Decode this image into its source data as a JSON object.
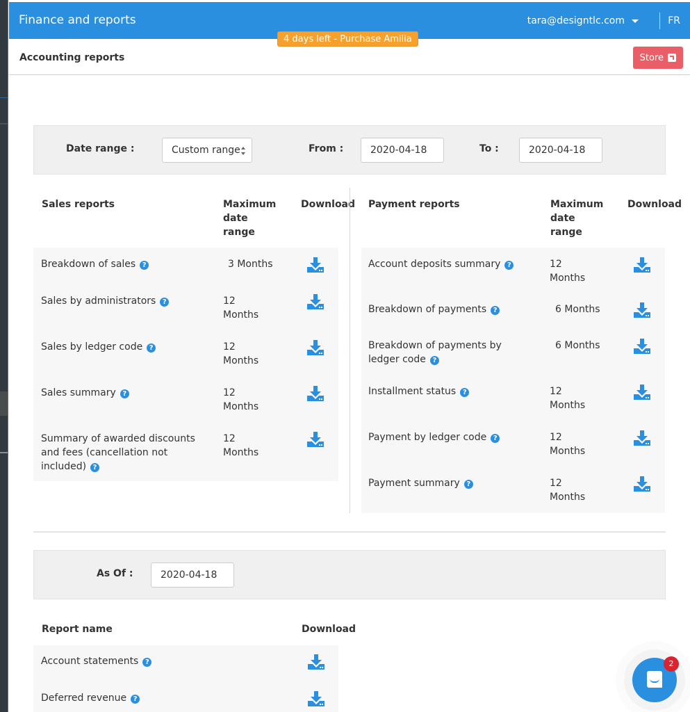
{
  "app": {
    "title": "Finance and reports",
    "user_email": "tara@designtlc.com",
    "language": "FR",
    "trial_banner": "4 days left - Purchase Amilia"
  },
  "subheader": {
    "title": "Accounting reports",
    "store_label": "Store"
  },
  "date_filter": {
    "date_range_label": "Date range :",
    "date_range_value": "Custom range",
    "from_label": "From :",
    "from_value": "2020-04-18",
    "to_label": "To :",
    "to_value": "2020-04-18"
  },
  "sales_reports": {
    "headers": {
      "name": "Sales reports",
      "range": "Maximum date range",
      "download": "Download"
    },
    "rows": [
      {
        "name": "Breakdown of sales",
        "range": "3 Months"
      },
      {
        "name": "Sales by administrators",
        "range": "12 Months"
      },
      {
        "name": "Sales by ledger code",
        "range": "12 Months"
      },
      {
        "name": "Sales summary",
        "range": "12 Months"
      },
      {
        "name": "Summary of awarded discounts and fees (cancellation not included)",
        "range": "12 Months"
      }
    ]
  },
  "payment_reports": {
    "headers": {
      "name": "Payment reports",
      "range": "Maximum date range",
      "download": "Download"
    },
    "rows": [
      {
        "name": "Account deposits summary",
        "range": "12 Months"
      },
      {
        "name": "Breakdown of payments",
        "range": "6 Months"
      },
      {
        "name": "Breakdown of payments by ledger code",
        "range": "6 Months"
      },
      {
        "name": "Installment status",
        "range": "12 Months"
      },
      {
        "name": "Payment by ledger code",
        "range": "12 Months"
      },
      {
        "name": "Payment summary",
        "range": "12 Months"
      }
    ]
  },
  "as_of_filter": {
    "label": "As Of :",
    "value": "2020-04-18"
  },
  "as_of_reports": {
    "headers": {
      "name": "Report name",
      "download": "Download"
    },
    "rows": [
      {
        "name": "Account statements"
      },
      {
        "name": "Deferred revenue"
      }
    ]
  },
  "chat": {
    "unread_count": "2"
  },
  "icons": {
    "help": "?",
    "download": "download-icon",
    "external_link": "external-link-icon",
    "chat": "chat-icon"
  },
  "colors": {
    "brand_blue": "#2b8fe0",
    "trial_orange": "#f5a12c",
    "store_red": "#ea5f67",
    "badge_red": "#d9232e",
    "sidebar_dark": "#323a3f"
  }
}
